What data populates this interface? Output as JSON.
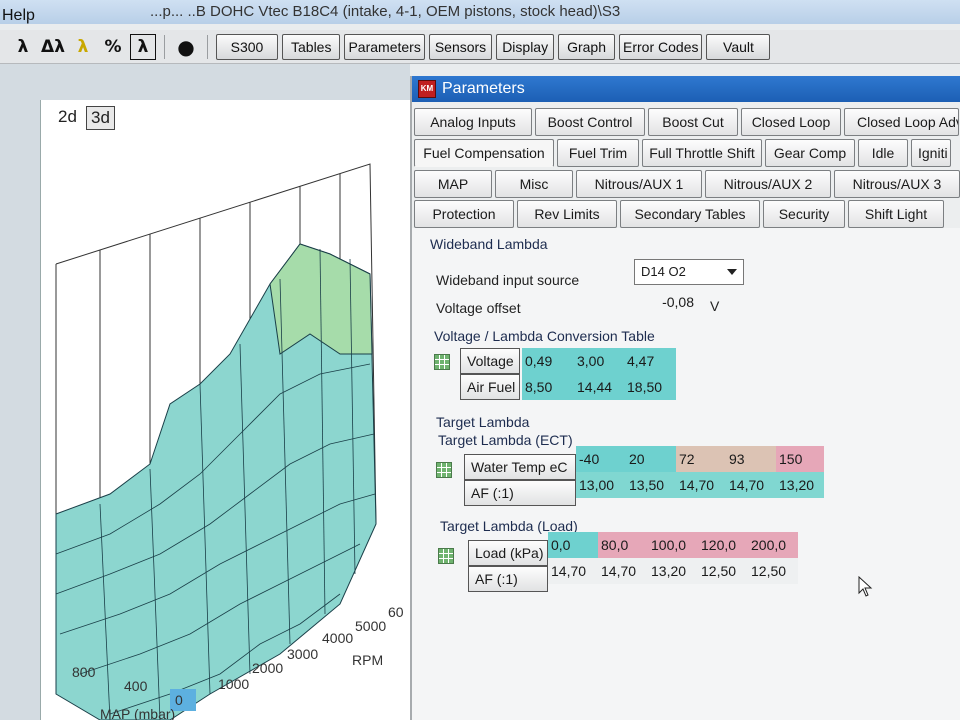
{
  "window": {
    "title": "...p... ..B DOHC Vtec B18C4 (intake, 4-1, OEM pistons, stock head)\\S3",
    "menu_help": "Help"
  },
  "toolbar": {
    "icons": [
      "lambda-icon",
      "delta-lambda-icon",
      "lambda-yellow-icon",
      "percent-icon",
      "lambda-box-icon",
      "record-icon"
    ],
    "icon_glyphs": [
      "λ",
      "Δλ",
      "λ",
      "%",
      "λ",
      "●"
    ],
    "buttons": [
      "S300",
      "Tables",
      "Parameters",
      "Sensors",
      "Display",
      "Graph",
      "Error Codes",
      "Vault"
    ]
  },
  "graph": {
    "view_2d": "2d",
    "view_3d": "3d",
    "rpm_label": "RPM",
    "map_label": "MAP (mbar)",
    "rpm_ticks": [
      "1000",
      "2000",
      "3000",
      "4000",
      "5000",
      "60"
    ],
    "map_ticks": [
      "800",
      "400",
      "0"
    ]
  },
  "params": {
    "title": "Parameters",
    "logo": "KM",
    "tabs_row1": [
      "Analog Inputs",
      "Boost Control",
      "Boost Cut",
      "Closed Loop",
      "Closed Loop Advan"
    ],
    "tabs_row2": [
      "Fuel Compensation",
      "Fuel Trim",
      "Full Throttle Shift",
      "Gear Comp",
      "Idle",
      "Igniti"
    ],
    "tabs_row3": [
      "MAP",
      "Misc",
      "Nitrous/AUX 1",
      "Nitrous/AUX 2",
      "Nitrous/AUX 3"
    ],
    "tabs_row4": [
      "Protection",
      "Rev Limits",
      "Secondary Tables",
      "Security",
      "Shift Light"
    ]
  },
  "wideband": {
    "section": "Wideband Lambda",
    "input_source_label": "Wideband input source",
    "input_source_value": "D14 O2",
    "voltage_offset_label": "Voltage offset",
    "voltage_offset_value": "-0,08",
    "voltage_offset_unit": "V",
    "conv_title": "Voltage / Lambda Conversion Table",
    "conv_row1_label": "Voltage",
    "conv_row1": [
      "0,49",
      "3,00",
      "4,47"
    ],
    "conv_row2_label": "Air Fuel",
    "conv_row2": [
      "8,50",
      "14,44",
      "18,50"
    ]
  },
  "target": {
    "section": "Target Lambda",
    "ect_title": "Target Lambda (ECT)",
    "ect_row1_label": "Water Temp eC",
    "ect_row1": [
      "-40",
      "20",
      "72",
      "93",
      "150"
    ],
    "ect_row2_label": "AF (:1)",
    "ect_row2": [
      "13,00",
      "13,50",
      "14,70",
      "14,70",
      "13,20"
    ],
    "load_title": "Target Lambda (Load)",
    "load_row1_label": "Load (kPa)",
    "load_row1": [
      "0,0",
      "80,0",
      "100,0",
      "120,0",
      "200,0"
    ],
    "load_row2_label": "AF (:1)",
    "load_row2": [
      "14,70",
      "14,70",
      "13,20",
      "12,50",
      "12,50"
    ]
  }
}
